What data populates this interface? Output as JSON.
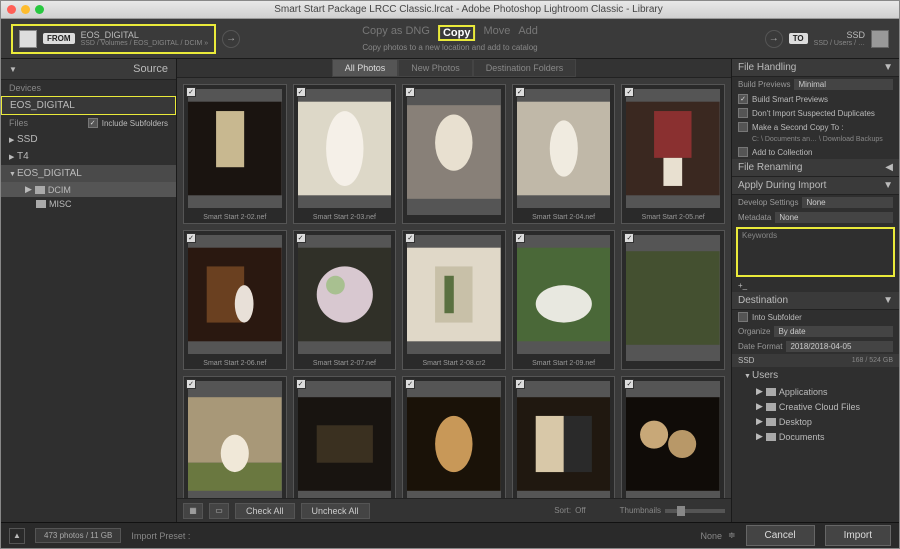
{
  "title": "Smart Start Package LRCC Classic.lrcat - Adobe Photoshop Lightroom Classic - Library",
  "from": {
    "label": "FROM",
    "device": "EOS_DIGITAL",
    "path": "SSD / Volumes / EOS_DIGITAL / DCIM »"
  },
  "commands": {
    "dng": "Copy as DNG",
    "copy": "Copy",
    "move": "Move",
    "add": "Add",
    "sub": "Copy photos to a new location and add to catalog"
  },
  "to": {
    "label": "TO",
    "device": "SSD",
    "path": "SSD / Users / …"
  },
  "source": {
    "header": "Source",
    "devices": "Devices",
    "eos": "EOS_DIGITAL",
    "files": "Files",
    "include": "Include Subfolders",
    "vols": [
      "SSD",
      "T4",
      "EOS_DIGITAL"
    ],
    "subs": [
      "DCIM",
      "MISC"
    ]
  },
  "tabs": {
    "all": "All Photos",
    "new": "New Photos",
    "dest": "Destination Folders"
  },
  "thumbs": [
    "Smart Start 2-02.nef",
    "Smart Start 2-03.nef",
    "",
    "Smart Start 2-04.nef",
    "Smart Start 2-05.nef",
    "Smart Start 2-06.nef",
    "Smart Start 2-07.nef",
    "Smart Start 2-08.cr2",
    "Smart Start 2-09.nef",
    "",
    "",
    "",
    "",
    "",
    ""
  ],
  "toolbar": {
    "checkall": "Check All",
    "uncheck": "Uncheck All",
    "sort": "Sort:",
    "sortval": "Off",
    "thumblbl": "Thumbnails"
  },
  "right": {
    "filehandling": "File Handling",
    "buildprev": "Build Previews",
    "buildprevval": "Minimal",
    "smart": "Build Smart Previews",
    "dup": "Don't Import Suspected Duplicates",
    "copy2": "Make a Second Copy To :",
    "copy2path": "C: \\ Documents an… \\ Download Backups",
    "addcol": "Add to Collection",
    "filerename": "File Renaming",
    "apply": "Apply During Import",
    "devset": "Develop Settings",
    "devsetval": "None",
    "meta": "Metadata",
    "metaval": "None",
    "keywords": "Keywords",
    "dest": "Destination",
    "intosub": "Into Subfolder",
    "organize": "Organize",
    "organizeval": "By date",
    "datefmt": "Date Format",
    "datefmtval": "2018/2018-04-05",
    "ssd": "SSD",
    "ssdinfo": "168 / 524 GB",
    "users": "Users",
    "folders": [
      "Applications",
      "Creative Cloud Files",
      "Desktop",
      "Documents"
    ]
  },
  "footer": {
    "stats": "473 photos / 11 GB",
    "preset": "Import Preset :",
    "presetval": "None",
    "cancel": "Cancel",
    "import": "Import"
  }
}
